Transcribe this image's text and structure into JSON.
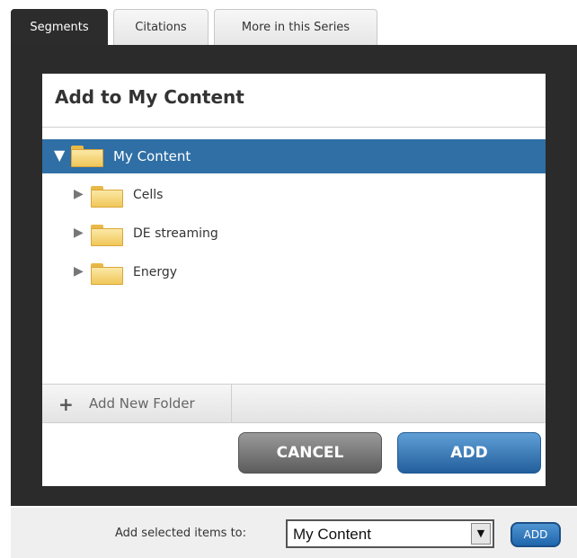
{
  "tabs": [
    {
      "label": "Segments",
      "active": true
    },
    {
      "label": "Citations",
      "active": false
    },
    {
      "label": "More in this Series",
      "active": false
    }
  ],
  "dialog": {
    "title": "Add to My Content",
    "tree": {
      "root": {
        "label": "My Content",
        "expanded": true,
        "selected": true,
        "icon": "folder-icon"
      },
      "children": [
        {
          "label": "Cells",
          "icon": "folder-icon"
        },
        {
          "label": "DE streaming",
          "icon": "folder-icon"
        },
        {
          "label": "Energy",
          "icon": "folder-icon"
        }
      ]
    },
    "add_folder_label": "Add New Folder",
    "cancel_label": "CANCEL",
    "add_label": "ADD"
  },
  "bottom_bar": {
    "label": "Add selected items to:",
    "select_value": "My Content",
    "add_label": "ADD"
  },
  "colors": {
    "selected_row": "#2f6fa5",
    "add_button": "#2a6aa8",
    "cancel_button": "#6f6f6f",
    "frame": "#2b2b2b"
  }
}
